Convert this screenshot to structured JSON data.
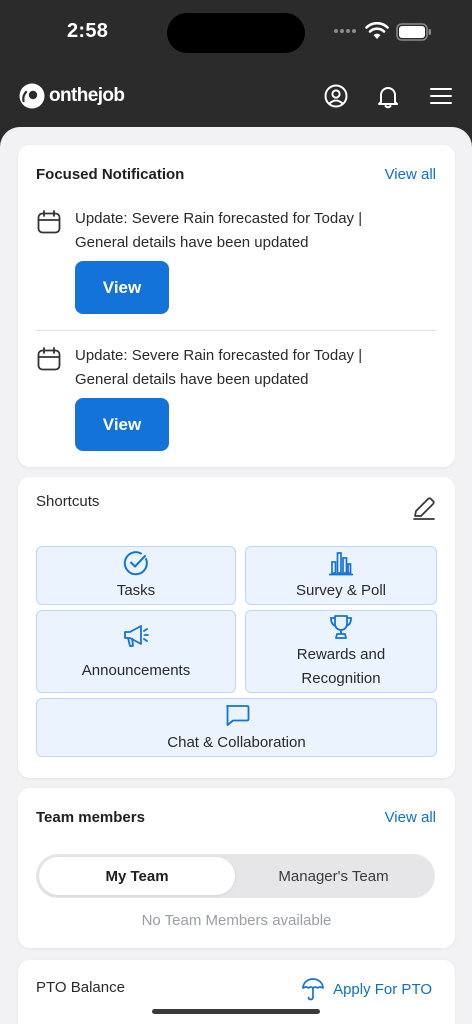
{
  "status_bar": {
    "time": "2:58"
  },
  "app": {
    "logo_text": "onthejob"
  },
  "focused_notification": {
    "title": "Focused Notification",
    "view_all": "View all",
    "items": [
      {
        "text": "Update: Severe Rain forecasted for Today | General details have been updated",
        "button": "View"
      },
      {
        "text": "Update: Severe Rain forecasted for Today | General details have been updated",
        "button": "View"
      }
    ]
  },
  "shortcuts": {
    "title": "Shortcuts",
    "tiles": [
      {
        "label": "Tasks",
        "icon": "check-circle-icon"
      },
      {
        "label": "Survey & Poll",
        "icon": "bar-chart-icon"
      },
      {
        "label": "Announcements",
        "icon": "megaphone-icon"
      },
      {
        "label": "Rewards and Recognition",
        "icon": "trophy-icon"
      },
      {
        "label": "Chat & Collaboration",
        "icon": "chat-icon"
      }
    ]
  },
  "team_members": {
    "title": "Team members",
    "view_all": "View all",
    "tabs": [
      "My Team",
      "Manager's Team"
    ],
    "empty_message": "No Team Members available"
  },
  "pto": {
    "title": "PTO Balance",
    "apply_label": "Apply For PTO"
  },
  "colors": {
    "accent": "#1473d9",
    "link": "#0f6fc6",
    "tile_bg": "#eaf3fe",
    "tile_border": "#bcd8f6",
    "header_bg": "#2b2b2b"
  }
}
